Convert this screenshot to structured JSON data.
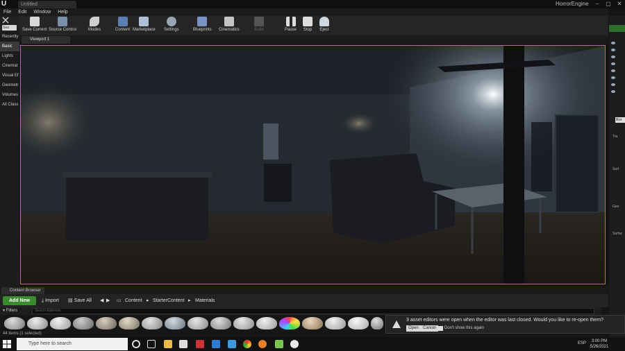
{
  "title_bar": {
    "tab_label": "Untitled",
    "project_name": "HorrorEngine",
    "window_buttons": [
      "–",
      "▢",
      "✕"
    ]
  },
  "menu": [
    "File",
    "Edit",
    "Window",
    "Help"
  ],
  "toolbar": {
    "items": [
      {
        "label": "Save Current",
        "icon": "save-icon",
        "enabled": true
      },
      {
        "label": "Source Control",
        "icon": "source-control-icon",
        "enabled": true
      },
      {
        "label": "Modes",
        "icon": "modes-icon",
        "enabled": true
      },
      {
        "label": "Content",
        "icon": "content-icon",
        "enabled": true
      },
      {
        "label": "Marketplace",
        "icon": "marketplace-icon",
        "enabled": true
      },
      {
        "label": "Settings",
        "icon": "settings-icon",
        "enabled": true
      },
      {
        "label": "Blueprints",
        "icon": "blueprints-icon",
        "enabled": true
      },
      {
        "label": "Cinematics",
        "icon": "cinematics-icon",
        "enabled": true
      },
      {
        "label": "Build",
        "icon": "build-icon",
        "enabled": false
      },
      {
        "label": "Pause",
        "icon": "pause-icon",
        "enabled": true
      },
      {
        "label": "Stop",
        "icon": "stop-icon",
        "enabled": true
      },
      {
        "label": "Eject",
        "icon": "eject-icon",
        "enabled": true
      }
    ]
  },
  "modes": {
    "search_placeholder": "Sea",
    "categories": [
      {
        "label": "Recently",
        "active": false
      },
      {
        "label": "Basic",
        "active": true
      },
      {
        "label": "Lights",
        "active": false
      },
      {
        "label": "Cinemat",
        "active": false
      },
      {
        "label": "Visual Ef",
        "active": false
      },
      {
        "label": "Geometr",
        "active": false
      },
      {
        "label": "Volumes",
        "active": false
      },
      {
        "label": "All Class",
        "active": false
      }
    ]
  },
  "viewport": {
    "tab_label": "Viewport 1"
  },
  "right_panel": {
    "details_search": "Box",
    "section_labels": [
      "Tra",
      "Surf",
      "Geo",
      "Surfac"
    ]
  },
  "content_browser": {
    "tab_label": "Content Browser",
    "add_new": "Add New",
    "import": "Import",
    "save_all": "Save All",
    "breadcrumb": [
      "Content",
      "StarterContent",
      "Materials"
    ],
    "filters": "Filters",
    "search_placeholder": "Search Materials",
    "status": "44 items (1 selected)",
    "view_options": "View Options"
  },
  "notification": {
    "message": "3 asset editors were open when the editor was last closed. Would you like to re-open them?",
    "open": "Open",
    "cancel": "Cancel",
    "dont_show": "Don't show this again"
  },
  "taskbar": {
    "search_placeholder": "Type here to search",
    "language": "ESP",
    "time": "3:00 PM",
    "date": "5/26/2021"
  },
  "colors": {
    "accent_green": "#3a8a2e",
    "viewport_border": "#b8860b"
  }
}
